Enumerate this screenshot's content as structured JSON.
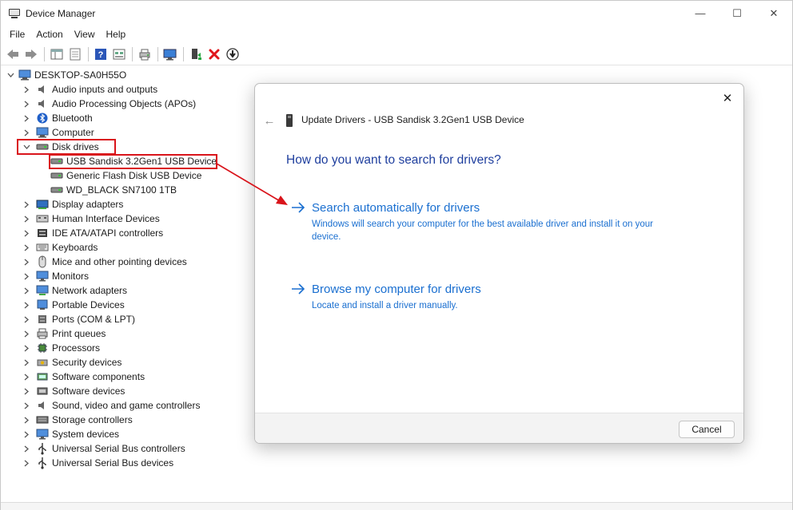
{
  "window": {
    "title": "Device Manager",
    "controls": {
      "minimize": "—",
      "maximize": "☐",
      "close": "✕"
    }
  },
  "menu": [
    "File",
    "Action",
    "View",
    "Help"
  ],
  "toolbar_icons": [
    "back-arrow-icon",
    "forward-arrow-icon",
    "show-hide-tree-icon",
    "properties-icon",
    "help-icon",
    "view-icon",
    "print-icon",
    "monitor-icon",
    "enable-device-icon",
    "uninstall-icon",
    "update-driver-icon"
  ],
  "tree": {
    "root": "DESKTOP-SA0H55O",
    "items": [
      {
        "label": "Audio inputs and outputs",
        "icon": "speaker-icon",
        "expanded": false
      },
      {
        "label": "Audio Processing Objects (APOs)",
        "icon": "speaker-icon",
        "expanded": false
      },
      {
        "label": "Bluetooth",
        "icon": "bluetooth-icon",
        "expanded": false
      },
      {
        "label": "Computer",
        "icon": "computer-icon",
        "expanded": false
      },
      {
        "label": "Disk drives",
        "icon": "disk-drive-icon",
        "expanded": true,
        "children": [
          "USB  Sandisk 3.2Gen1 USB Device",
          "Generic Flash Disk USB Device",
          "WD_BLACK SN7100 1TB"
        ]
      },
      {
        "label": "Display adapters",
        "icon": "display-adapter-icon",
        "expanded": false
      },
      {
        "label": "Human Interface Devices",
        "icon": "hid-icon",
        "expanded": false
      },
      {
        "label": "IDE ATA/ATAPI controllers",
        "icon": "ide-controller-icon",
        "expanded": false
      },
      {
        "label": "Keyboards",
        "icon": "keyboard-icon",
        "expanded": false
      },
      {
        "label": "Mice and other pointing devices",
        "icon": "mouse-icon",
        "expanded": false
      },
      {
        "label": "Monitors",
        "icon": "monitor-icon",
        "expanded": false
      },
      {
        "label": "Network adapters",
        "icon": "network-adapter-icon",
        "expanded": false
      },
      {
        "label": "Portable Devices",
        "icon": "portable-device-icon",
        "expanded": false
      },
      {
        "label": "Ports (COM & LPT)",
        "icon": "port-icon",
        "expanded": false
      },
      {
        "label": "Print queues",
        "icon": "printer-icon",
        "expanded": false
      },
      {
        "label": "Processors",
        "icon": "processor-icon",
        "expanded": false
      },
      {
        "label": "Security devices",
        "icon": "security-device-icon",
        "expanded": false
      },
      {
        "label": "Software components",
        "icon": "software-component-icon",
        "expanded": false
      },
      {
        "label": "Software devices",
        "icon": "software-device-icon",
        "expanded": false
      },
      {
        "label": "Sound, video and game controllers",
        "icon": "speaker-icon",
        "expanded": false
      },
      {
        "label": "Storage controllers",
        "icon": "storage-controller-icon",
        "expanded": false
      },
      {
        "label": "System devices",
        "icon": "system-device-icon",
        "expanded": false
      },
      {
        "label": "Universal Serial Bus controllers",
        "icon": "usb-icon",
        "expanded": false
      },
      {
        "label": "Universal Serial Bus devices",
        "icon": "usb-icon",
        "expanded": false
      }
    ]
  },
  "dialog": {
    "title": "Update Drivers -  USB  Sandisk 3.2Gen1 USB Device",
    "question": "How do you want to search for drivers?",
    "options": [
      {
        "title": "Search automatically for drivers",
        "desc": "Windows will search your computer for the best available driver and install it on your device."
      },
      {
        "title": "Browse my computer for drivers",
        "desc": "Locate and install a driver manually."
      }
    ],
    "cancel": "Cancel",
    "close": "✕",
    "back": "←"
  },
  "colors": {
    "link_blue": "#1a6fd0",
    "heading_blue": "#1f3f9e",
    "annotation_red": "#d9141b"
  }
}
